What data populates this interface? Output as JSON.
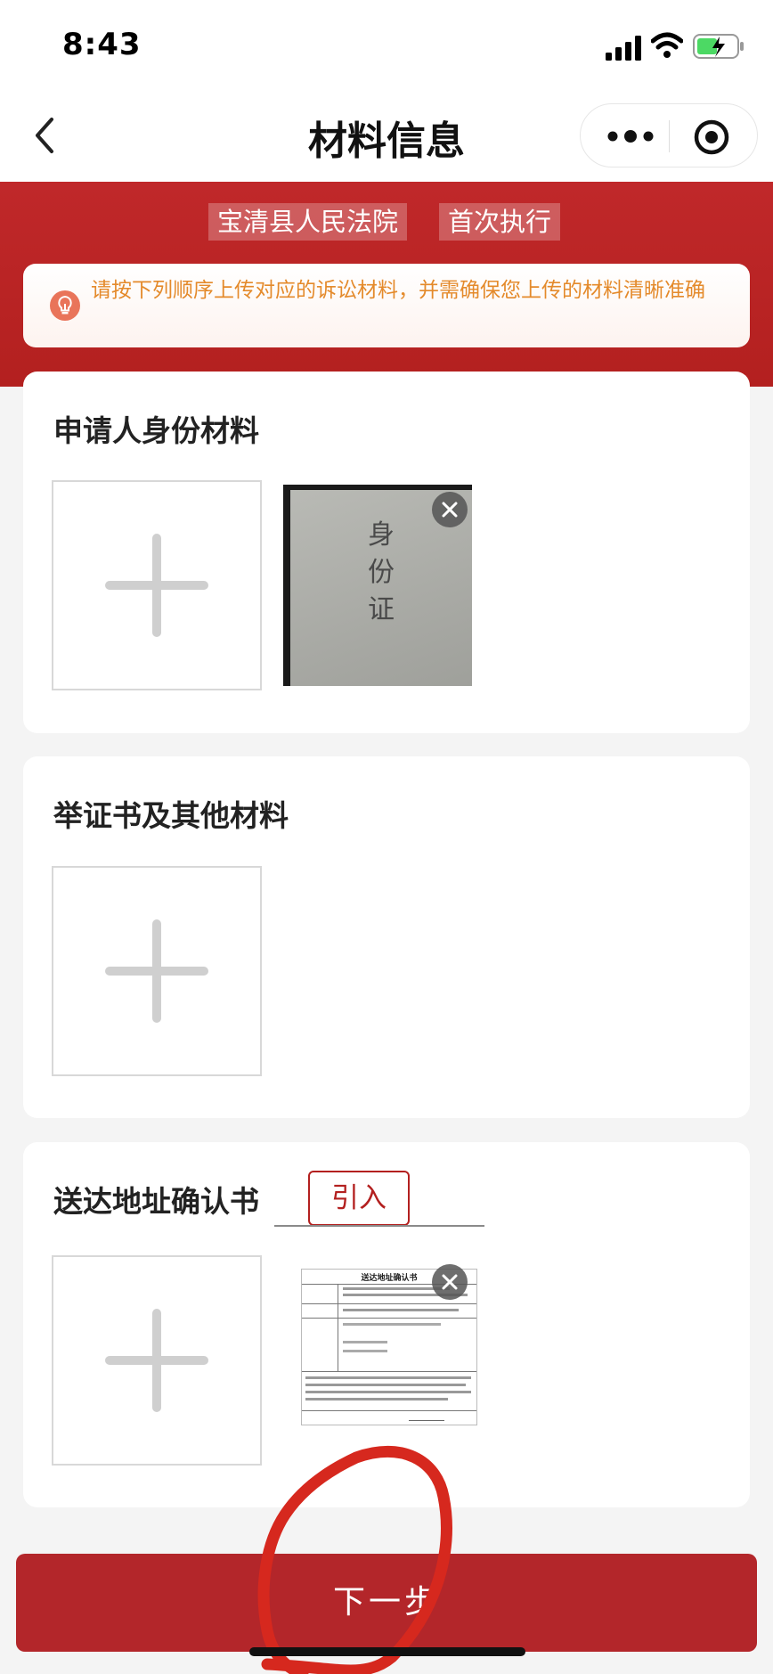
{
  "status_bar": {
    "time": "8:43"
  },
  "nav": {
    "title": "材料信息"
  },
  "header": {
    "tags": [
      "宝清县人民法院",
      "首次执行"
    ],
    "notice": "请按下列顺序上传对应的诉讼材料，并需确保您上传的材料清晰准确"
  },
  "sections": [
    {
      "title": "申请人身份材料",
      "thumb_text": "身份证"
    },
    {
      "title": "举证书及其他材料"
    },
    {
      "title": "送达地址确认书",
      "import_label": "引入",
      "doc_title": "送达地址确认书"
    }
  ],
  "footer": {
    "next_label": "下一步"
  },
  "colors": {
    "brand_red": "#b3201f",
    "notice_orange": "#e48a2b"
  }
}
